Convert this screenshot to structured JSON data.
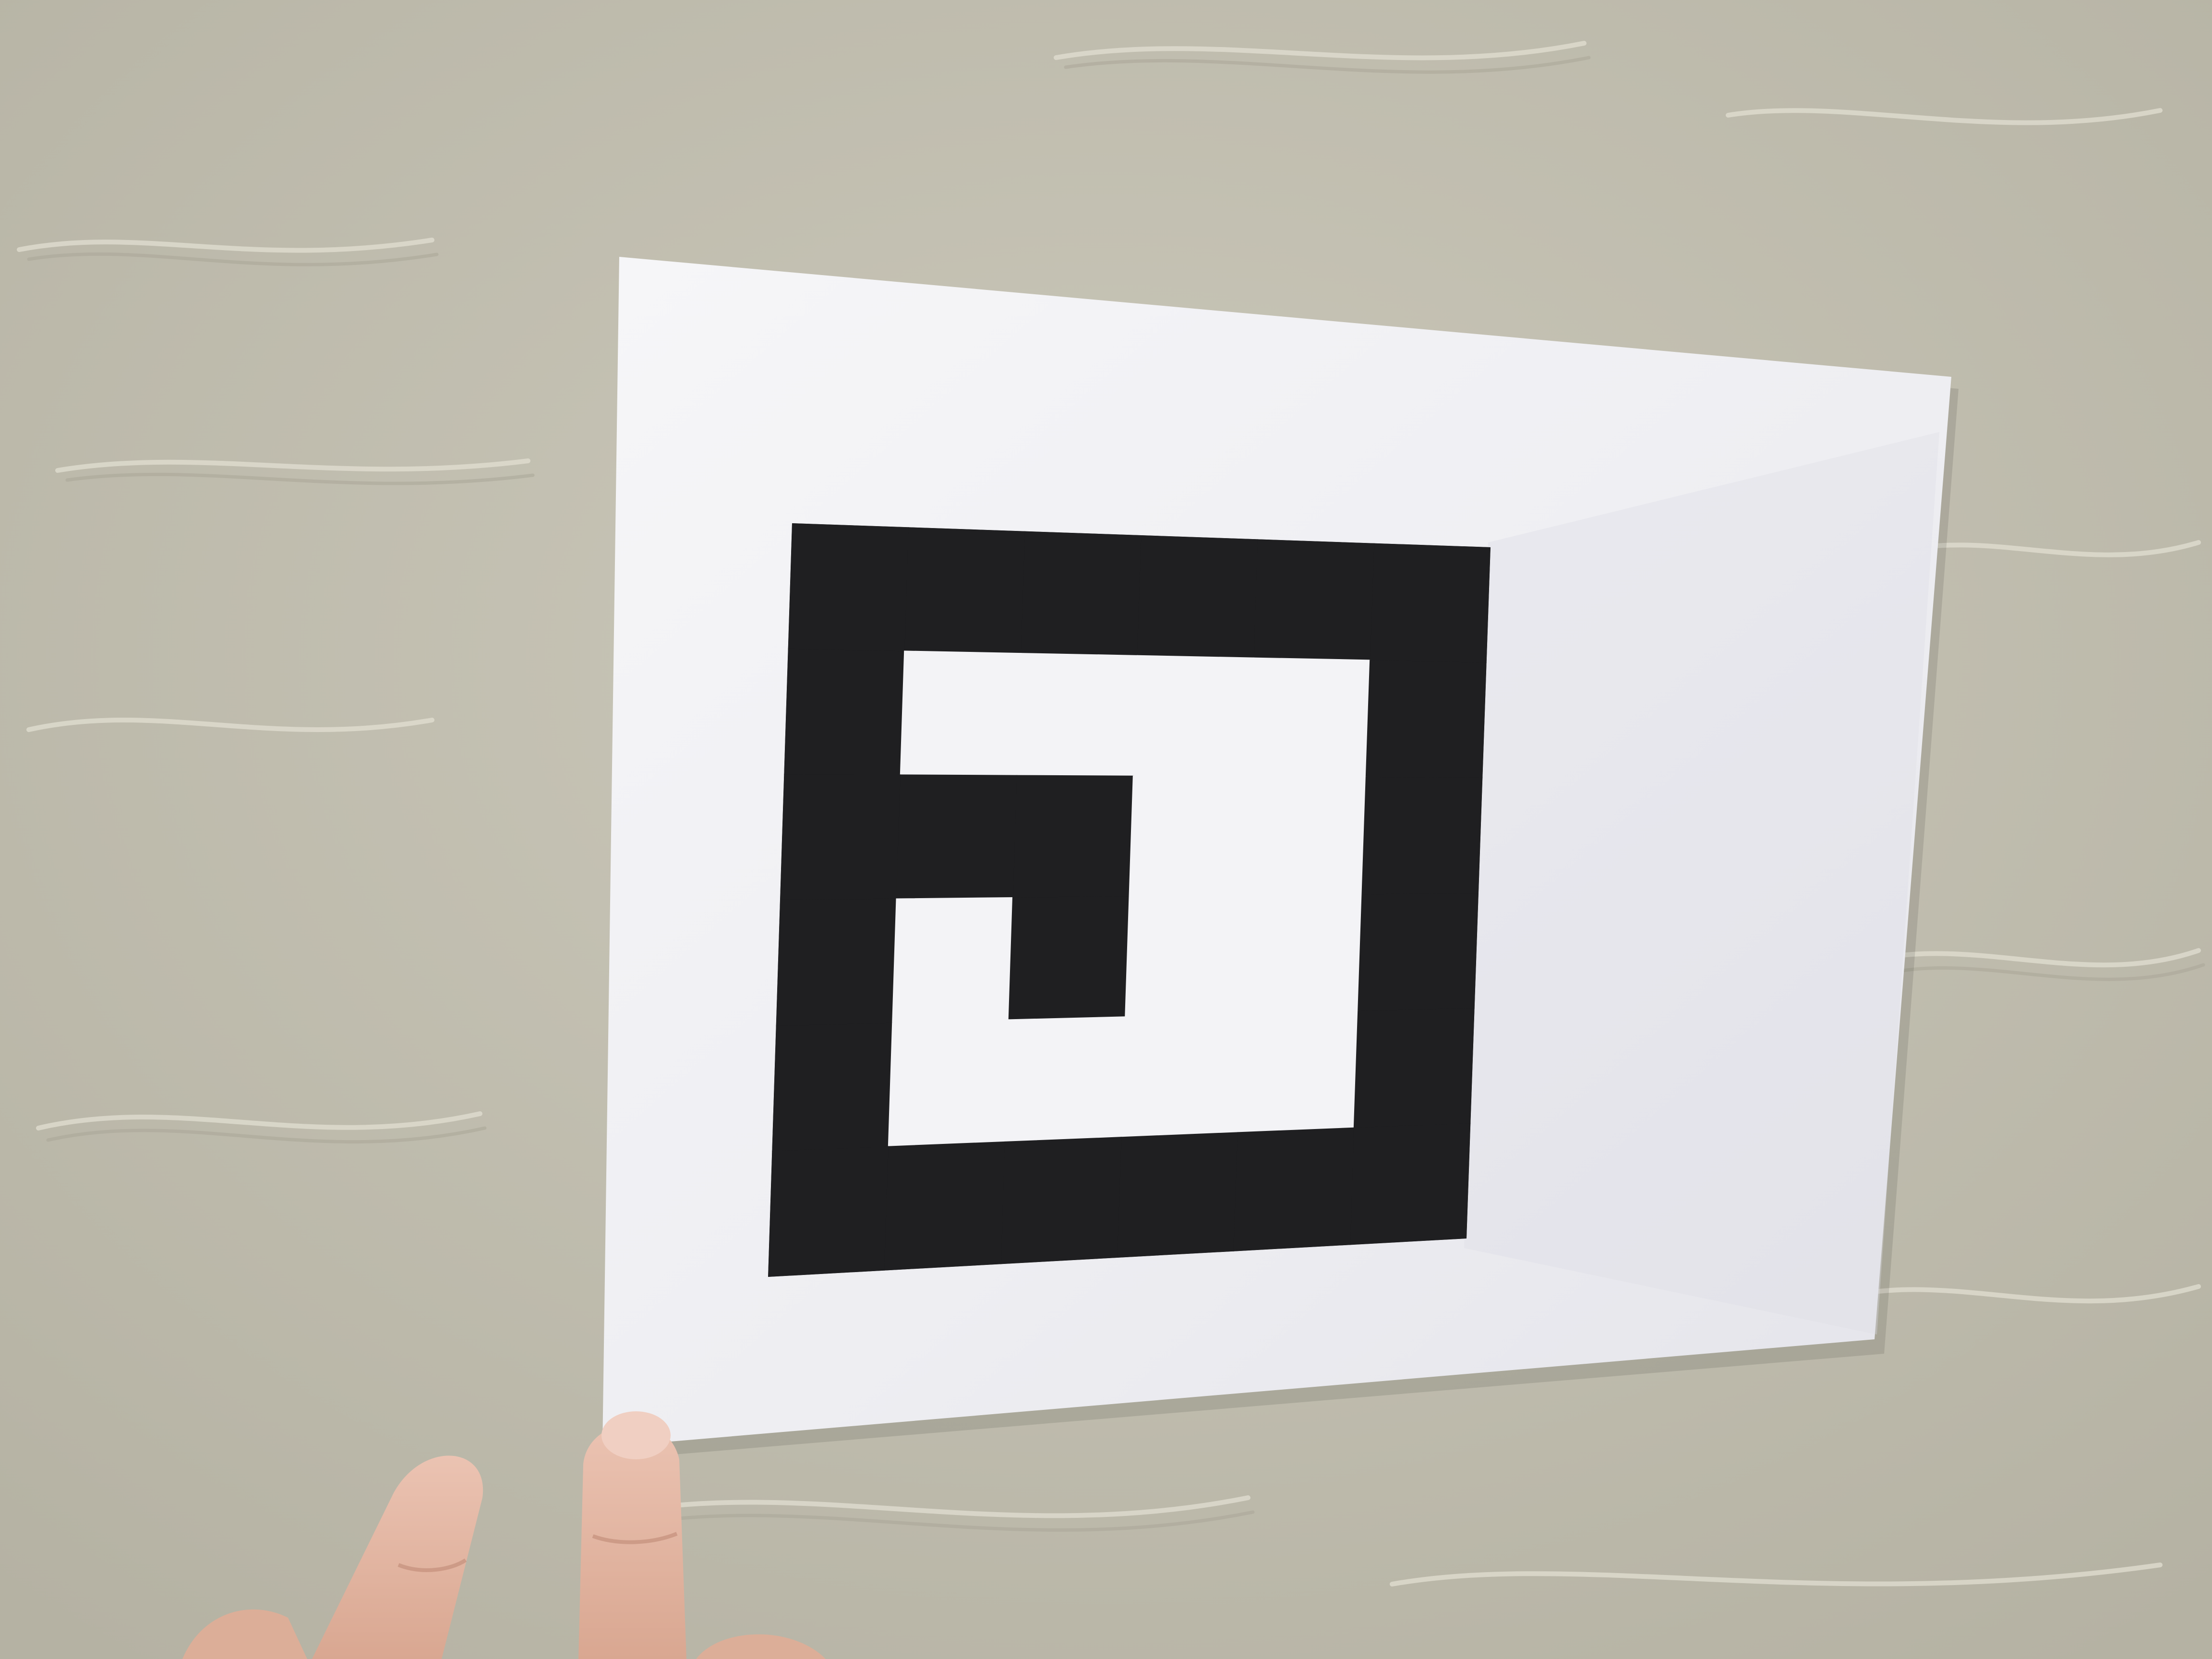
{
  "scene": {
    "subject": "fiducial-marker-sheet",
    "wall_color": "#c6c3b4",
    "paper_color": "#f3f3f6",
    "marker_color": "#1f1f21",
    "skin_color": "#e3b8a4"
  },
  "marker": {
    "grid_size": 6,
    "bit_grid": [
      [
        0,
        0,
        0,
        0,
        0,
        0
      ],
      [
        0,
        1,
        1,
        1,
        1,
        0
      ],
      [
        0,
        0,
        0,
        1,
        1,
        0
      ],
      [
        0,
        1,
        0,
        1,
        1,
        0
      ],
      [
        0,
        1,
        1,
        1,
        1,
        0
      ],
      [
        0,
        0,
        0,
        0,
        0,
        0
      ]
    ]
  }
}
